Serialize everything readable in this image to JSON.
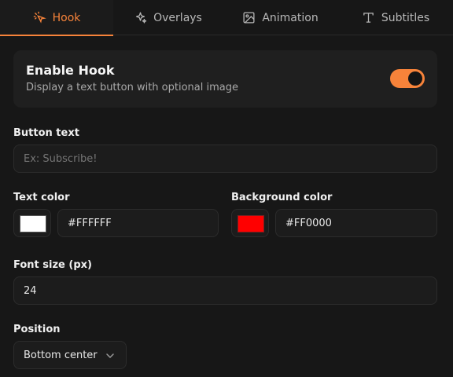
{
  "tabs": [
    {
      "label": "Hook",
      "icon": "hook-sparkle-icon",
      "active": true
    },
    {
      "label": "Overlays",
      "icon": "sparkles-icon",
      "active": false
    },
    {
      "label": "Animation",
      "icon": "image-icon",
      "active": false
    },
    {
      "label": "Subtitles",
      "icon": "type-icon",
      "active": false
    }
  ],
  "enable": {
    "title": "Enable Hook",
    "description": "Display a text button with optional image",
    "enabled": true
  },
  "button_text": {
    "label": "Button text",
    "placeholder": "Ex: Subscribe!",
    "value": ""
  },
  "text_color": {
    "label": "Text color",
    "value": "#FFFFFF",
    "swatch": "#FFFFFF"
  },
  "background_color": {
    "label": "Background color",
    "value": "#FF0000",
    "swatch": "#FF0000"
  },
  "font_size": {
    "label": "Font size (px)",
    "value": "24"
  },
  "position": {
    "label": "Position",
    "value": "Bottom center"
  },
  "colors": {
    "accent": "#F7833A",
    "background": "#171717"
  }
}
